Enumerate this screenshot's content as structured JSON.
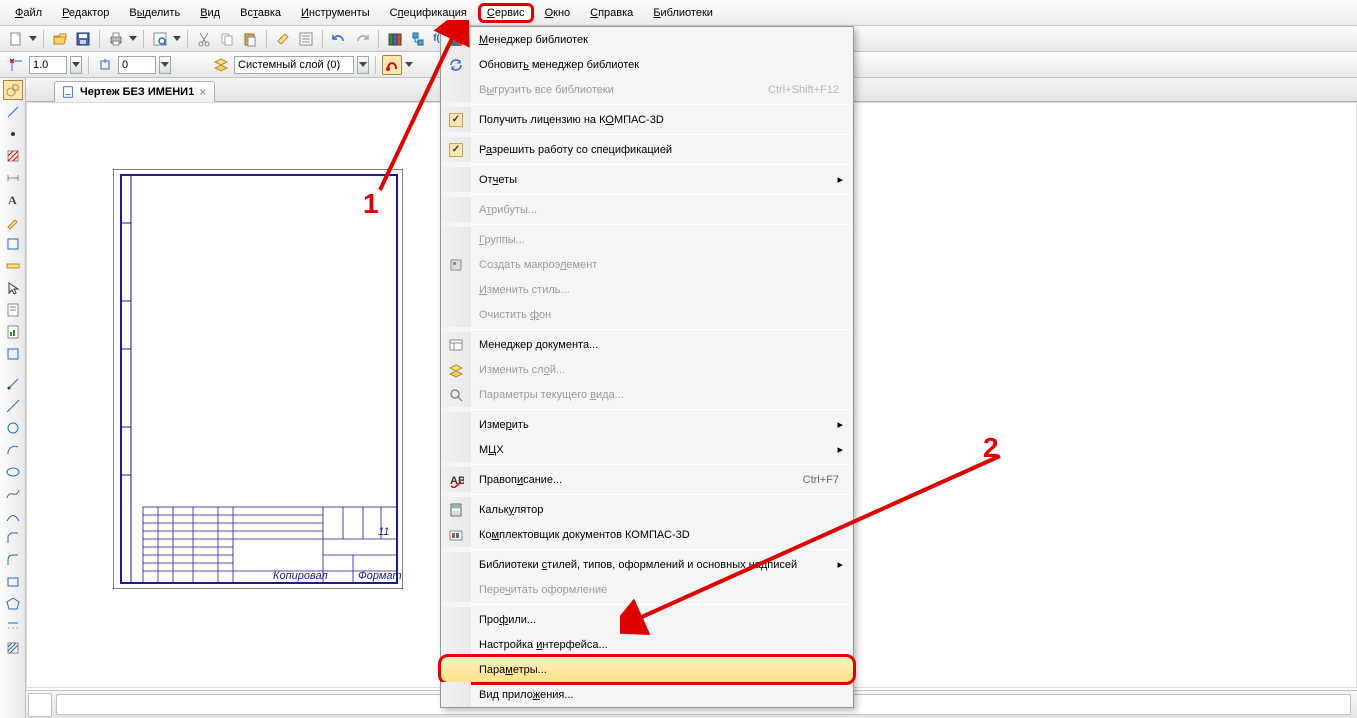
{
  "menubar": {
    "items": [
      {
        "label": "Файл",
        "u": 0
      },
      {
        "label": "Редактор",
        "u": 0
      },
      {
        "label": "Выделить",
        "u": 1
      },
      {
        "label": "Вид",
        "u": 0
      },
      {
        "label": "Вставка",
        "u": 2
      },
      {
        "label": "Инструменты",
        "u": 0
      },
      {
        "label": "Спецификация",
        "u": 1
      },
      {
        "label": "Сервис",
        "u": 0
      },
      {
        "label": "Окно",
        "u": 0
      },
      {
        "label": "Справка",
        "u": 0
      },
      {
        "label": "Библиотеки",
        "u": 0
      }
    ]
  },
  "toolbar2": {
    "scale_value": "1.0",
    "step_value": "0",
    "layer_label": "Системный слой (0)"
  },
  "tab": {
    "title": "Чертеж БЕЗ ИМЕНИ1"
  },
  "dropdown": {
    "items": [
      {
        "label": "Менеджер библиотек",
        "icon": "lib",
        "enabled": true,
        "u": 0
      },
      {
        "label": "Обновить менеджер библиотек",
        "icon": "refresh",
        "enabled": true,
        "u": 7
      },
      {
        "label": "Выгрузить все библиотеки",
        "shortcut": "Ctrl+Shift+F12",
        "enabled": false,
        "u": 1
      },
      {
        "divider": true
      },
      {
        "label": "Получить лицензию на КОМПАС-3D",
        "icon": "check",
        "enabled": true,
        "u": 22
      },
      {
        "divider": true
      },
      {
        "label": "Разрешить работу со спецификацией",
        "icon": "check",
        "enabled": true,
        "u": 1
      },
      {
        "divider": true
      },
      {
        "label": "Отчеты",
        "submenu": true,
        "enabled": true,
        "u": 2
      },
      {
        "divider": true
      },
      {
        "label": "Атрибуты...",
        "enabled": false,
        "u": 1
      },
      {
        "divider": true
      },
      {
        "label": "Группы...",
        "enabled": false,
        "u": 0
      },
      {
        "label": "Создать макроэлемент",
        "icon": "macro",
        "enabled": false,
        "u": 14
      },
      {
        "label": "Изменить стиль...",
        "enabled": false,
        "u": 0
      },
      {
        "label": "Очистить фон",
        "enabled": false,
        "u": 9
      },
      {
        "divider": true
      },
      {
        "label": "Менеджер документа...",
        "icon": "docmgr",
        "enabled": true,
        "u": 9
      },
      {
        "label": "Изменить слой...",
        "icon": "layer",
        "enabled": false,
        "u": 11
      },
      {
        "label": "Параметры текущего вида...",
        "icon": "viewparam",
        "enabled": false,
        "u": 19
      },
      {
        "divider": true
      },
      {
        "label": "Измерить",
        "submenu": true,
        "enabled": true,
        "u": 4
      },
      {
        "label": "МЦХ",
        "submenu": true,
        "enabled": true,
        "u": 1
      },
      {
        "divider": true
      },
      {
        "label": "Правописание...",
        "icon": "spell",
        "shortcut": "Ctrl+F7",
        "enabled": true,
        "u": 6
      },
      {
        "divider": true
      },
      {
        "label": "Калькулятор",
        "icon": "calc",
        "enabled": true,
        "u": 5
      },
      {
        "label": "Комплектовщик документов КОМПАС-3D",
        "icon": "kit",
        "enabled": true,
        "u": 2
      },
      {
        "divider": true
      },
      {
        "label": "Библиотеки стилей, типов, оформлений и основных надписей",
        "submenu": true,
        "enabled": true,
        "u": 11
      },
      {
        "label": "Перечитать оформление",
        "enabled": false,
        "u": 4
      },
      {
        "divider": true
      },
      {
        "label": "Профили...",
        "enabled": true,
        "u": 3
      },
      {
        "label": "Настройка интерфейса...",
        "enabled": true,
        "u": 10
      },
      {
        "label": "Параметры...",
        "highlighted": true,
        "enabled": true,
        "u": 4
      },
      {
        "label": "Вид приложения...",
        "enabled": true,
        "u": 9
      }
    ]
  },
  "annotations": {
    "one": "1",
    "two": "2"
  }
}
